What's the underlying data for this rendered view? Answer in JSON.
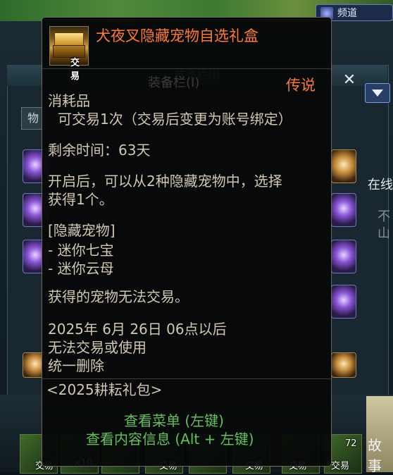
{
  "background": {
    "search_label": "频道",
    "window_title": "装备栏(I)",
    "tab_label": "物",
    "side_right_1": "在线",
    "side_right_2": "不\n山",
    "story_label": "故事",
    "bottom_tags": [
      "交易",
      "×10",
      "交易",
      "交易",
      "交易",
      "交易",
      "72"
    ]
  },
  "tooltip": {
    "item_name": "犬夜叉隐藏宠物自选礼盒",
    "icon_tag": "交易",
    "rarity": "传说",
    "category": "消耗品",
    "trade_rule": "可交易1次（交易后变更为账号绑定）",
    "remaining_time": "剩余时间：63天",
    "desc_line1": "开启后，可以从2种隐藏宠物中，选择",
    "desc_line2": "获得1个。",
    "hidden_pet_header": "[隐藏宠物]",
    "pet_1": "- 迷你七宝",
    "pet_2": "- 迷你云母",
    "pet_note": "获得的宠物无法交易。",
    "expiry_line1": "2025年 6月 26日 06点以后",
    "expiry_line2": "无法交易或使用",
    "expiry_line3": "统一删除",
    "package_source": "<2025耕耘礼包>",
    "hint_menu": "查看菜单 (左键)",
    "hint_info": "查看内容信息 (Alt + 左键)"
  },
  "colors": {
    "item_name": "#ff7a2e",
    "body_text": "#d2c7b1",
    "hint_text": "#62c25a"
  }
}
